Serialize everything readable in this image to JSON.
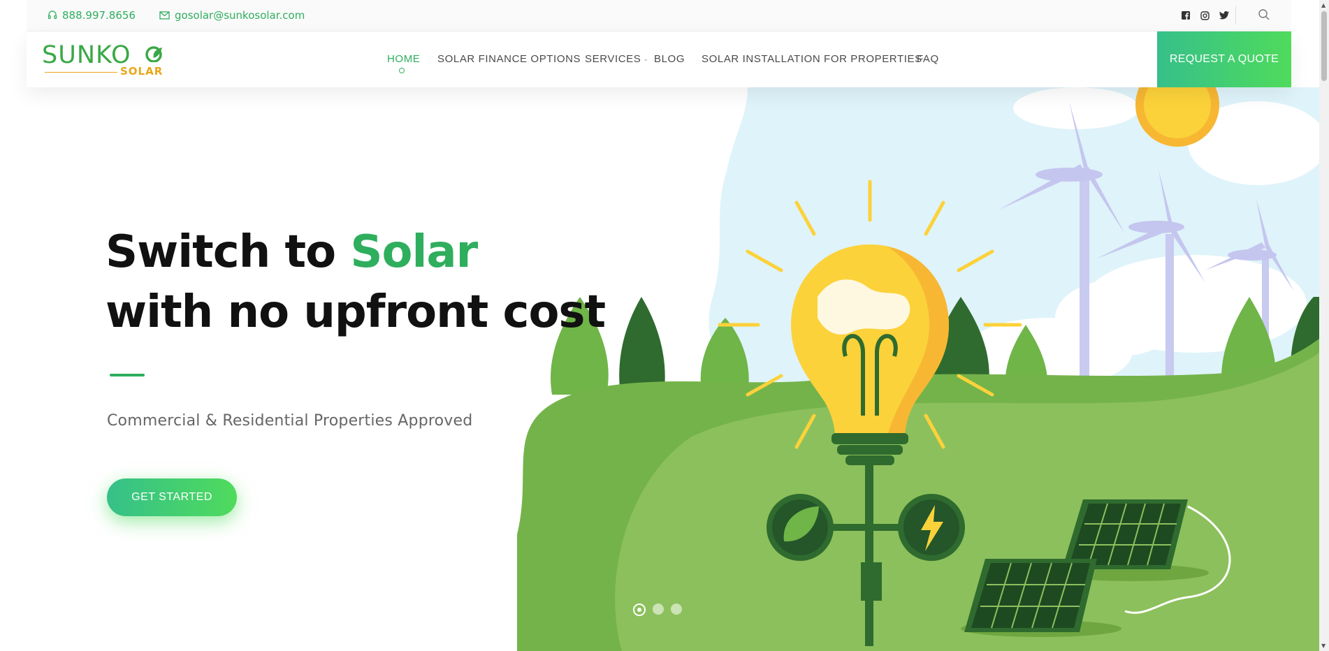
{
  "topbar": {
    "phone": "888.997.8656",
    "email": "gosolar@sunkosolar.com",
    "social_icons": [
      "facebook-icon",
      "instagram-icon",
      "twitter-icon"
    ],
    "search_icon": "search-icon"
  },
  "header": {
    "logo_main": "SUNKO",
    "logo_sub": "SOLAR",
    "nav": [
      {
        "label": "HOME",
        "active": true
      },
      {
        "label": "SOLAR FINANCE OPTIONS"
      },
      {
        "label": "SERVICES",
        "dropdown": true
      },
      {
        "label": "BLOG"
      },
      {
        "label": "SOLAR INSTALLATION FOR PROPERTIES",
        "dropdown": true
      },
      {
        "label": "FAQ"
      }
    ],
    "quote_button": "REQUEST A QUOTE"
  },
  "hero": {
    "title_part1": "Switch to ",
    "title_accent": "Solar",
    "title_line2": "with no upfront cost",
    "subtitle": "Commercial & Residential Properties Approved",
    "cta": "GET STARTED",
    "slides_total": 3,
    "active_slide": 1
  },
  "colors": {
    "brand_green": "#2fae5e",
    "gradient_start": "#36c08a",
    "gradient_end": "#4fdb5c",
    "logo_orange": "#e9a61a"
  }
}
